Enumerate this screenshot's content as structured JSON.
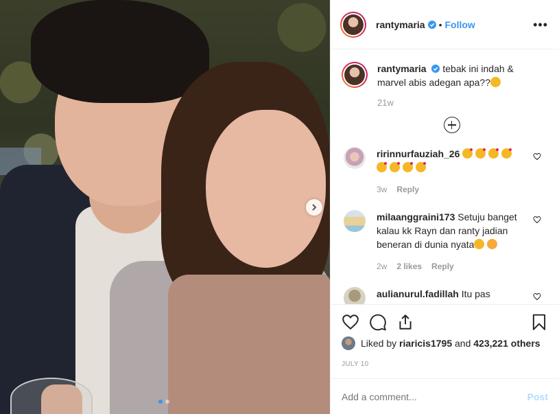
{
  "header": {
    "username": "rantymaria",
    "separator": "•",
    "follow_label": "Follow",
    "more_label": "•••"
  },
  "caption": {
    "username": "rantymaria",
    "text": "tebak ini indah & marvel abis adegan apa??",
    "time": "21w"
  },
  "comments": [
    {
      "username": "ririnnurfauziah_26",
      "time": "3w",
      "likes": "",
      "reply_label": "Reply"
    },
    {
      "username": "milaanggraini173",
      "text": "Setuju banget kalau kk Rayn dan ranty jadian beneran di dunia nyata",
      "time": "2w",
      "likes": "2 likes",
      "reply_label": "Reply"
    },
    {
      "username": "aulianurul.fadillah",
      "text": "Itu pas adegan"
    }
  ],
  "likes": {
    "prefix": "Liked by",
    "user": "riaricis1795",
    "connector": "and",
    "count": "423,221 others"
  },
  "date": "JULY 10",
  "add_comment": {
    "placeholder": "Add a comment...",
    "post_label": "Post"
  },
  "carousel": {
    "current": 1,
    "total": 2
  },
  "colors": {
    "accent": "#3897f0",
    "post_disabled": "#b3dbff",
    "muted": "#999999"
  }
}
